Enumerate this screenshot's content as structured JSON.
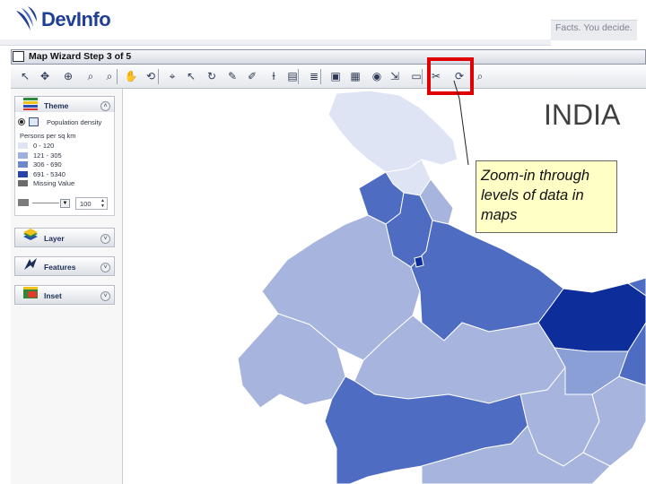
{
  "header": {
    "logo_text": "DevInfo",
    "tagline": "Facts. You decide.",
    "logo_icon": "devinfo-swoosh-icon"
  },
  "window": {
    "title": "Map Wizard   Step 3 of 5"
  },
  "toolbar": {
    "buttons": [
      "select-icon",
      "pan-icon",
      "full-extent-icon",
      "zoom-in-icon",
      "zoom-out-icon",
      "hand-icon",
      "back-icon",
      "label-icon",
      "select-arrow-icon",
      "rotate-icon",
      "draw-icon",
      "edit-icon",
      "text-cursor-icon",
      "legend-icon",
      "layer-order-icon",
      "save-icon",
      "image-icon",
      "circle-icon",
      "export-icon",
      "frame-icon",
      "tools-icon",
      "refresh-icon",
      "zoom-levels-icon",
      "data-icon"
    ]
  },
  "panel": {
    "theme": {
      "label": "Theme",
      "indicator": "Population density",
      "unit": "Persons per sq km",
      "legend": [
        {
          "label": "0 - 120",
          "color": "#dfe4f4"
        },
        {
          "label": "121 - 305",
          "color": "#9fb0de"
        },
        {
          "label": "306 - 690",
          "color": "#6d86cc"
        },
        {
          "label": "691 - 5340",
          "color": "#2745a8"
        },
        {
          "label": "Missing Value",
          "color": "#6c6c6c"
        }
      ],
      "opacity_value": "100"
    },
    "layer": {
      "label": "Layer"
    },
    "features": {
      "label": "Features"
    },
    "inset": {
      "label": "Inset"
    }
  },
  "map": {
    "title": "INDIA",
    "colors": {
      "lightest": "#dfe4f4",
      "light": "#a7b5de",
      "medium": "#8a9fd6",
      "strong": "#4e6cc2",
      "darkest": "#0d2d9a"
    }
  },
  "annotation": {
    "callout": "Zoom-in through levels of data in maps",
    "highlight_color": "#e00000"
  }
}
